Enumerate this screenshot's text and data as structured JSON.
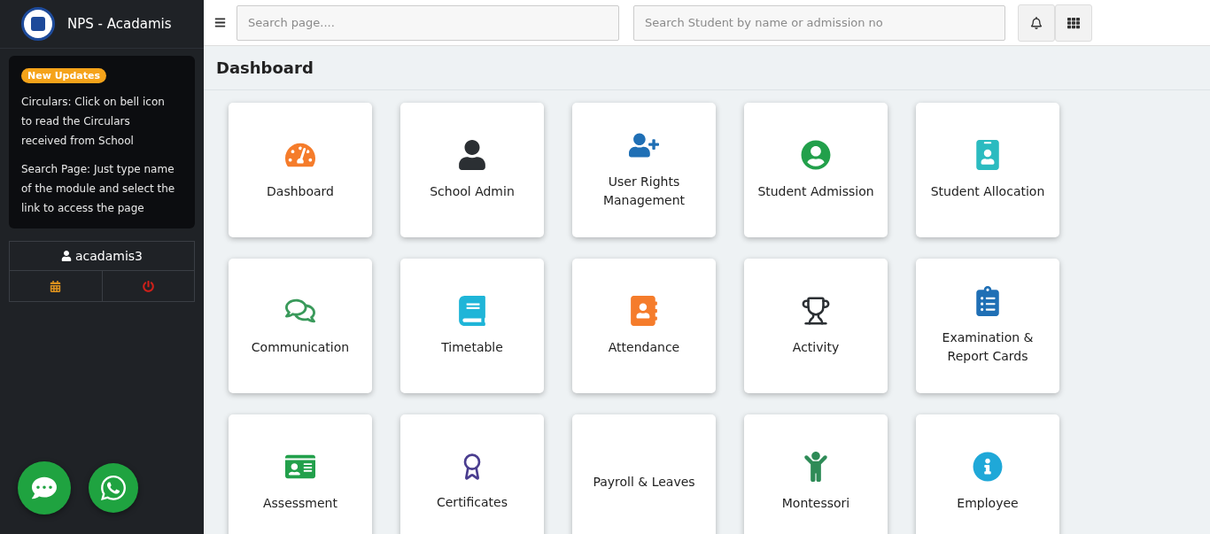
{
  "app": {
    "title": "NPS - Acadamis"
  },
  "updates": {
    "badge": "New Updates",
    "items": [
      "Circulars: Click on bell icon to read the Circulars received from School",
      "Search Page: Just type name of the module and select the link to access the page"
    ]
  },
  "user": {
    "name": "acadamis3"
  },
  "topbar": {
    "page_search": {
      "placeholder": "Search page...."
    },
    "student_search": {
      "placeholder": "Search Student by name or admission no"
    }
  },
  "page": {
    "title": "Dashboard"
  },
  "modules": [
    {
      "label": "Dashboard",
      "kind": "gauge"
    },
    {
      "label": "School Admin",
      "kind": "user"
    },
    {
      "label": "User Rights Management",
      "kind": "userplus"
    },
    {
      "label": "Student Admission",
      "kind": "usercircle"
    },
    {
      "label": "Student Allocation",
      "kind": "badge"
    },
    {
      "label": "Communication",
      "kind": "comments"
    },
    {
      "label": "Timetable",
      "kind": "book"
    },
    {
      "label": "Attendance",
      "kind": "addressbook"
    },
    {
      "label": "Activity",
      "kind": "trophy"
    },
    {
      "label": "Examination & Report Cards",
      "kind": "clipboard"
    },
    {
      "label": "Assessment",
      "kind": "idcard"
    },
    {
      "label": "Certificates",
      "kind": "award"
    },
    {
      "label": "Payroll & Leaves",
      "kind": "none"
    },
    {
      "label": "Montessori",
      "kind": "child"
    },
    {
      "label": "Employee",
      "kind": "info"
    }
  ]
}
